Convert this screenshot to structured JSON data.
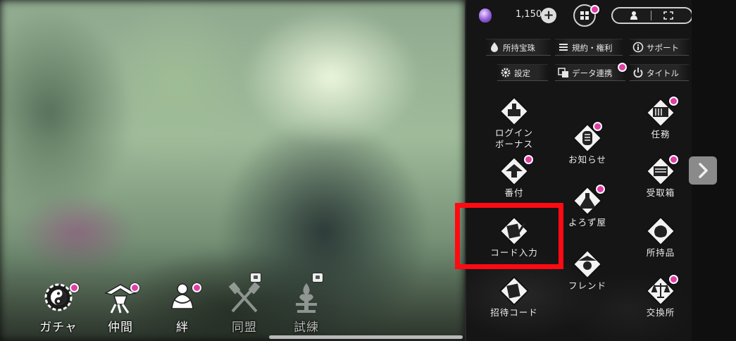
{
  "currency": {
    "amount": "1,150",
    "icon": "gem-icon",
    "add": "+"
  },
  "top_buttons": [
    "grid-menu-icon",
    "person-icon",
    "fullscreen-icon"
  ],
  "system_buttons": [
    {
      "label": "所持宝珠",
      "icon": "drop-icon"
    },
    {
      "label": "規約・権利",
      "icon": "list-icon"
    },
    {
      "label": "サポート",
      "icon": "info-icon"
    },
    {
      "label": "設定",
      "icon": "gear-icon"
    },
    {
      "label": "データ連携",
      "icon": "data-link-icon"
    },
    {
      "label": "タイトル",
      "icon": "power-icon"
    }
  ],
  "menu": {
    "login_bonus": {
      "label1": "ログイン",
      "label2": "ボーナス"
    },
    "notice": "お知らせ",
    "tasks": "任務",
    "ranking": "番付",
    "inbox": "受取箱",
    "shop": "よろず屋",
    "code_input": "コード入力",
    "inventory": "所持品",
    "friend": "フレンド",
    "invite_code": "招待コード",
    "exchange": "交換所"
  },
  "bottom_nav": [
    {
      "label": "ガチャ",
      "state": "badge"
    },
    {
      "label": "仲間",
      "state": "badge"
    },
    {
      "label": "絆",
      "state": "badge"
    },
    {
      "label": "同盟",
      "state": "locked"
    },
    {
      "label": "試練",
      "state": "locked"
    }
  ],
  "colors": {
    "badge": "#e03ea6",
    "highlight": "#ff0a12",
    "panel": "#151515"
  }
}
